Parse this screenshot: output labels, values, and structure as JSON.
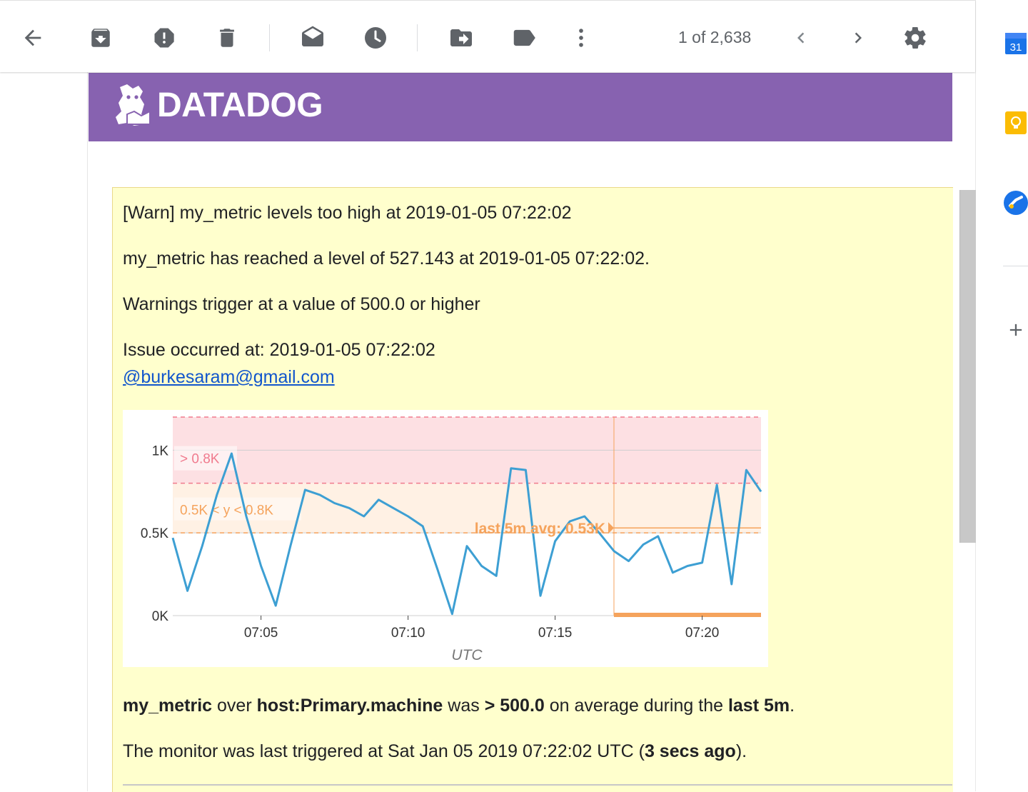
{
  "toolbar": {
    "pager_text": "1 of 2,638",
    "icons": [
      "back-arrow-icon",
      "archive-icon",
      "report-spam-icon",
      "delete-icon",
      "mark-unread-icon",
      "snooze-icon",
      "move-to-icon",
      "label-icon",
      "more-vert-icon",
      "chevron-left-icon",
      "chevron-right-icon",
      "settings-gear-icon"
    ]
  },
  "side_panel": {
    "calendar_day": "31",
    "icons": [
      "calendar-icon",
      "keep-icon",
      "tasks-icon",
      "add-icon"
    ]
  },
  "email": {
    "brand": "DATADOG",
    "title_line": "[Warn] my_metric levels too high at 2019-01-05 07:22:02",
    "level_line": "my_metric has reached a level of 527.143 at 2019-01-05 07:22:02.",
    "threshold_line": "Warnings trigger at a value of 500.0 or higher",
    "issue_line": "Issue occurred at: 2019-01-05 07:22:02",
    "mention": "@burkesaram@gmail.com",
    "summary": {
      "metric": "my_metric",
      "over": " over ",
      "host": "host:Primary.machine",
      "was": " was ",
      "cond": "> 500.0",
      "mid": " on average during the ",
      "window": "last 5m",
      "end": "."
    },
    "trigger": {
      "prefix": "The monitor was last triggered at Sat Jan 05 2019 07:22:02 UTC (",
      "ago": "3 secs ago",
      "suffix": ")."
    }
  },
  "colors": {
    "brand_purple": "#8762b0",
    "alert_bg": "#ffffcd",
    "series_blue": "#3d9fd3",
    "critical_red": "#f07b8e",
    "warning_orange": "#f5a35c",
    "link_blue": "#1155cc"
  },
  "chart_data": {
    "type": "line",
    "xlabel": "UTC",
    "ylabel": "",
    "x_ticks": [
      "07:05",
      "07:10",
      "07:15",
      "07:20"
    ],
    "y_ticks": [
      "0K",
      "0.5K",
      "1K"
    ],
    "ylim": [
      0,
      1200
    ],
    "critical_band_label": "> 0.8K",
    "warning_band_label": "0.5K < y < 0.8K",
    "critical_threshold": 800,
    "warning_threshold": 500,
    "avg_label": "last 5m avg: 0.53K",
    "avg_value": 530,
    "grid": true,
    "series": [
      {
        "x": [
          "07:02",
          "07:02:30",
          "07:03",
          "07:03:30",
          "07:04",
          "07:04:30",
          "07:05",
          "07:05:30",
          "07:06",
          "07:06:30",
          "07:07",
          "07:07:30",
          "07:08",
          "07:08:30",
          "07:09",
          "07:09:30",
          "07:10",
          "07:10:30",
          "07:11",
          "07:11:30",
          "07:12",
          "07:12:30",
          "07:13",
          "07:13:30",
          "07:14",
          "07:14:30",
          "07:15",
          "07:15:30",
          "07:16",
          "07:16:30",
          "07:17",
          "07:17:30",
          "07:18",
          "07:18:30",
          "07:19",
          "07:19:30",
          "07:20",
          "07:20:30",
          "07:21",
          "07:21:30",
          "07:22"
        ],
        "values": [
          470,
          150,
          420,
          730,
          980,
          600,
          300,
          60,
          420,
          760,
          730,
          680,
          650,
          600,
          700,
          650,
          600,
          540,
          280,
          10,
          420,
          300,
          240,
          890,
          880,
          120,
          450,
          570,
          600,
          500,
          390,
          330,
          430,
          480,
          260,
          300,
          320,
          790,
          190,
          880,
          750
        ]
      }
    ]
  }
}
